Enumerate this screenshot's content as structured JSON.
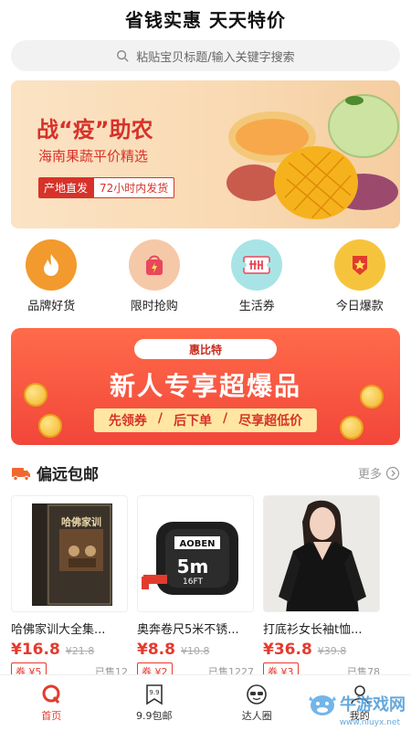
{
  "header": {
    "title": "省钱实惠 天天特价"
  },
  "search": {
    "placeholder": "粘贴宝贝标题/输入关键字搜索"
  },
  "hero": {
    "title": "战“疫”助农",
    "subtitle": "海南果蔬平价精选",
    "tag_left": "产地直发",
    "tag_right": "72小时内发货"
  },
  "quick_nav": [
    {
      "label": "品牌好货",
      "icon": "flame-icon",
      "color": "#f29a2e"
    },
    {
      "label": "限时抢购",
      "icon": "shopping-bag-icon",
      "color": "#f5c8a8"
    },
    {
      "label": "生活券",
      "icon": "ticket-icon",
      "color": "#a8e4e6"
    },
    {
      "label": "今日爆款",
      "icon": "star-badge-icon",
      "color": "#f6c43c"
    }
  ],
  "promo": {
    "logo": "惠比特",
    "headline": "新人专享超爆品",
    "steps": [
      "先领券",
      "后下单",
      "尽享超低价"
    ]
  },
  "section": {
    "title": "偏远包邮",
    "more": "更多"
  },
  "products": [
    {
      "name": "哈佛家训大全集...",
      "price": "¥16.8",
      "old_price": "¥21.8",
      "coupon": "券 ¥5",
      "sold": "已售12"
    },
    {
      "name": "奥奔卷尺5米不锈...",
      "price": "¥8.8",
      "old_price": "¥10.8",
      "coupon": "券 ¥2",
      "sold": "已售1227"
    },
    {
      "name": "打底衫女长袖t恤...",
      "price": "¥36.8",
      "old_price": "¥39.8",
      "coupon": "券 ¥3",
      "sold": "已售78"
    }
  ],
  "product_image_text": {
    "book_title": "哈佛家训",
    "tape_brand": "AOBEN",
    "tape_size": "5m",
    "tape_ft": "16FT"
  },
  "tabbar": [
    {
      "label": "首页",
      "icon": "home-q-icon",
      "active": true
    },
    {
      "label": "9.9包邮",
      "icon": "bookmark-99-icon",
      "active": false
    },
    {
      "label": "达人圈",
      "icon": "sunglasses-face-icon",
      "active": false
    },
    {
      "label": "我的",
      "icon": "user-icon",
      "active": false
    }
  ],
  "watermark": {
    "text": "牛游戏网",
    "sub": "www.niuyx.net"
  },
  "colors": {
    "accent": "#e53a2e",
    "hero_bg": "#fbe3c4",
    "promo_bg": "#f2463a"
  }
}
